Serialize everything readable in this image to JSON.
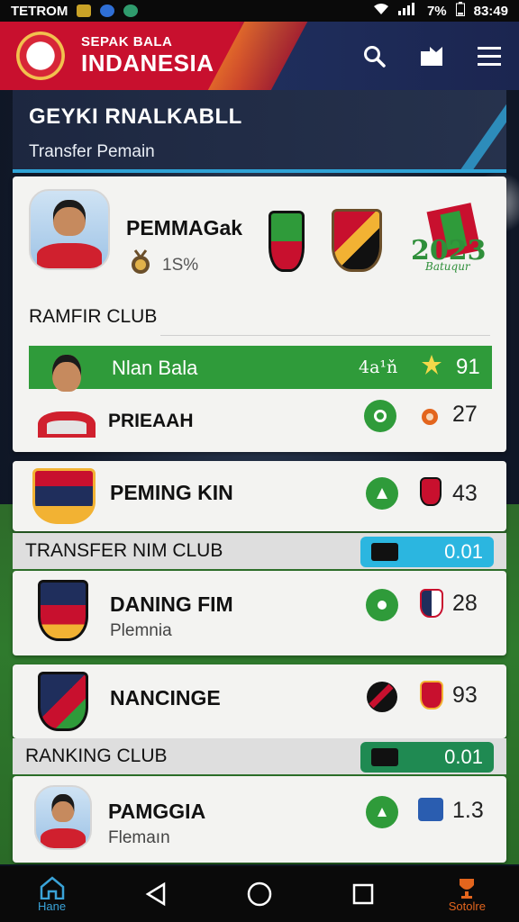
{
  "status_bar": {
    "left_text": "TETROM",
    "battery": "7%",
    "time": "83:49"
  },
  "app": {
    "brand_small": "SEPAK BALA",
    "brand_big": "INDANESIA"
  },
  "icons": {
    "search": "search-icon",
    "share": "share-icon",
    "menu": "menu-icon"
  },
  "page": {
    "title": "GEYKI RNALKABLL",
    "subtitle": "Transfer Pemain"
  },
  "featured": {
    "name": "PEMMAGak",
    "stat": "1S%",
    "badge_text": "2023",
    "badge_sub": "Batuqur"
  },
  "section1": {
    "label": "RAMFIR CLUB",
    "highlight": {
      "name": "Nlan Bala",
      "info": "4a¹ň",
      "value": "91"
    },
    "row": {
      "name": "PRIEAAH",
      "value": "27"
    }
  },
  "club1": {
    "name": "PEMING KIN",
    "value": "43"
  },
  "band1": {
    "label": "TRANSFER NIM CLUB",
    "value": "0.01"
  },
  "club2": {
    "name": "DANING FIM",
    "sub": "Plemnia",
    "value": "28"
  },
  "club3": {
    "name": "NANCINGE",
    "value": "93"
  },
  "band2": {
    "label": "RANKING CLUB",
    "value": "0.01"
  },
  "club4": {
    "name": "PAMGGIA",
    "sub": "Flemaın",
    "value": "1.3"
  },
  "nav": {
    "home": "Hane",
    "right": "Sotolre"
  },
  "colors": {
    "red": "#c8102e",
    "navy": "#1f2e5c",
    "green": "#2f9b3a",
    "cyan": "#2bb6e0",
    "dark_green": "#1f8a52"
  }
}
